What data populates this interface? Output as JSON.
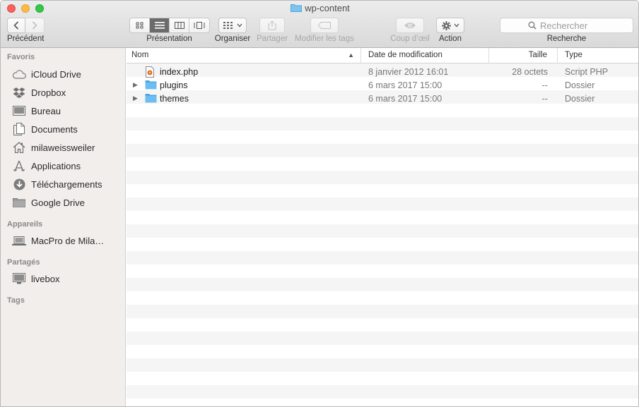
{
  "window": {
    "title": "wp-content"
  },
  "toolbar": {
    "back_label": "Précédent",
    "view_label": "Présentation",
    "arrange_label": "Organiser",
    "share_label": "Partager",
    "tags_label": "Modifier les tags",
    "quicklook_label": "Coup d’œil",
    "action_label": "Action",
    "search_label": "Recherche",
    "search_placeholder": "Rechercher"
  },
  "sidebar": {
    "favorites_header": "Favoris",
    "favorites": [
      {
        "label": "iCloud Drive",
        "icon": "cloud-icon"
      },
      {
        "label": "Dropbox",
        "icon": "dropbox-icon"
      },
      {
        "label": "Bureau",
        "icon": "desktop-icon"
      },
      {
        "label": "Documents",
        "icon": "documents-icon"
      },
      {
        "label": "milaweissweiler",
        "icon": "home-icon"
      },
      {
        "label": "Applications",
        "icon": "applications-icon"
      },
      {
        "label": "Téléchargements",
        "icon": "downloads-icon"
      },
      {
        "label": "Google Drive",
        "icon": "folder-icon"
      }
    ],
    "devices_header": "Appareils",
    "devices": [
      {
        "label": "MacPro de Mila…",
        "icon": "laptop-icon"
      }
    ],
    "shared_header": "Partagés",
    "shared": [
      {
        "label": "livebox",
        "icon": "monitor-icon"
      }
    ],
    "tags_header": "Tags"
  },
  "columns": {
    "name": "Nom",
    "date": "Date de modification",
    "size": "Taille",
    "type": "Type"
  },
  "files": [
    {
      "name": "index.php",
      "date": "8 janvier 2012 16:01",
      "size": "28 octets",
      "type": "Script PHP",
      "icon": "php-file-icon"
    },
    {
      "name": "plugins",
      "date": "6 mars 2017 15:00",
      "size": "--",
      "type": "Dossier",
      "icon": "folder-icon"
    },
    {
      "name": "themes",
      "date": "6 mars 2017 15:00",
      "size": "--",
      "type": "Dossier",
      "icon": "folder-icon"
    }
  ],
  "colors": {
    "folder": "#5ab3ea",
    "sidebar_bg": "#f1eeec",
    "toolbar_bg": "#dcdcdc"
  }
}
